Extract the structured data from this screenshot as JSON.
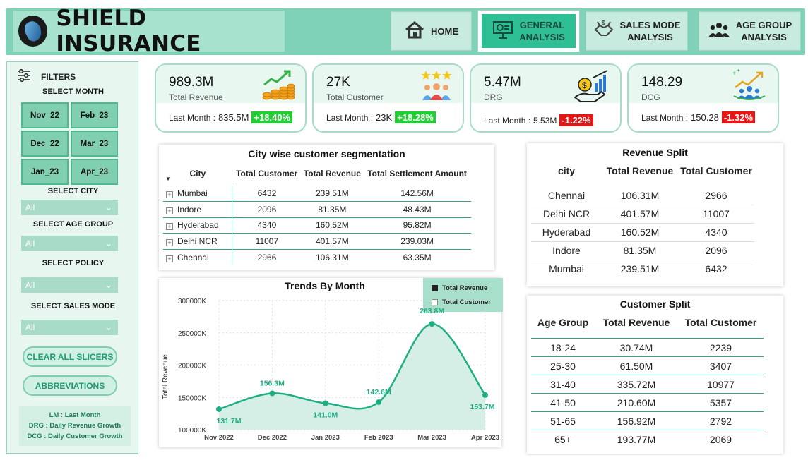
{
  "header": {
    "title": "SHIELD INSURANCE",
    "nav": [
      {
        "label_line1": "HOME",
        "label_line2": "",
        "icon": "home-icon"
      },
      {
        "label_line1": "GENERAL",
        "label_line2": "ANALYSIS",
        "icon": "presentation-chart-icon"
      },
      {
        "label_line1": "SALES MODE",
        "label_line2": "ANALYSIS",
        "icon": "handshake-icon"
      },
      {
        "label_line1": "AGE GROUP",
        "label_line2": "ANALYSIS",
        "icon": "people-group-icon"
      }
    ]
  },
  "sidebar": {
    "filters_title": "FILTERS",
    "select_month": "SELECT MONTH",
    "months": [
      "Nov_22",
      "Feb_23",
      "Dec_22",
      "Mar_23",
      "Jan_23",
      "Apr_23"
    ],
    "select_city": "SELECT CITY",
    "city_value": "All",
    "select_age_group": "SELECT  AGE GROUP",
    "age_value": "All",
    "select_policy": "SELECT POLICY",
    "policy_value": "All",
    "select_sales_mode": "SELECT SALES MODE",
    "sales_mode_value": "All",
    "clear_button": "CLEAR ALL SLICERS",
    "abbr_button": "ABBREVIATIONS",
    "abbreviations": [
      "LM : Last Month",
      "DRG : Daily Revenue Growth",
      "DCG : Daily Customer Growth"
    ]
  },
  "kpis": [
    {
      "value": "989.3M",
      "name": "Total Revenue",
      "lm_label": "Last Month : ",
      "lm_value": "835.5M",
      "change": "+18.40%",
      "trend": "up",
      "icon": "coins-growth-icon"
    },
    {
      "value": "27K",
      "name": "Total Customer",
      "lm_label": "Last Month : ",
      "lm_value": "23K",
      "change": "+18.28%",
      "trend": "up",
      "icon": "customers-rating-icon"
    },
    {
      "value": "5.47M",
      "name": "DRG",
      "lm_label": "Last Month : ",
      "lm_value": "5.53M",
      "change": "-1.22%",
      "trend": "down",
      "icon": "money-hand-chart-icon"
    },
    {
      "value": "148.29",
      "name": "DCG",
      "lm_label": "Last Month : ",
      "lm_value": "150.28",
      "change": "-1.32%",
      "trend": "down",
      "icon": "group-growth-icon"
    }
  ],
  "city_segmentation": {
    "title": "City wise customer segmentation",
    "columns": [
      "City",
      "Total Customer",
      "Total Revenue",
      "Total Settlement Amount"
    ],
    "rows": [
      [
        "Mumbai",
        "6432",
        "239.51M",
        "142.56M"
      ],
      [
        "Indore",
        "2096",
        "81.35M",
        "48.43M"
      ],
      [
        "Hyderabad",
        "4340",
        "160.52M",
        "95.82M"
      ],
      [
        "Delhi NCR",
        "11007",
        "401.57M",
        "239.03M"
      ],
      [
        "Chennai",
        "2966",
        "106.31M",
        "63.35M"
      ]
    ]
  },
  "revenue_split": {
    "title": "Revenue Split",
    "columns": [
      "city",
      "Total Revenue",
      "Total Customer"
    ],
    "rows": [
      [
        "Chennai",
        "106.31M",
        "2966"
      ],
      [
        "Delhi NCR",
        "401.57M",
        "11007"
      ],
      [
        "Hyderabad",
        "160.52M",
        "4340"
      ],
      [
        "Indore",
        "81.35M",
        "2096"
      ],
      [
        "Mumbai",
        "239.51M",
        "6432"
      ]
    ]
  },
  "customer_split": {
    "title": "Customer Split",
    "columns": [
      "Age Group",
      "Total Revenue",
      "Total Customer"
    ],
    "rows": [
      [
        "18-24",
        "30.74M",
        "2239"
      ],
      [
        "25-30",
        "61.50M",
        "3407"
      ],
      [
        "31-40",
        "335.72M",
        "10977"
      ],
      [
        "41-50",
        "210.60M",
        "5357"
      ],
      [
        "51-65",
        "156.92M",
        "2792"
      ],
      [
        "65+",
        "193.77M",
        "2069"
      ]
    ]
  },
  "chart_data": {
    "type": "area",
    "title": "Trends By Month",
    "ylabel": "Total Revenue",
    "xlabel": "",
    "categories": [
      "Nov 2022",
      "Dec 2022",
      "Jan 2023",
      "Feb 2023",
      "Mar 2023",
      "Apr 2023"
    ],
    "series": [
      {
        "name": "Total Revenue",
        "values": [
          131.7,
          156.3,
          141.0,
          142.6,
          263.8,
          153.7
        ],
        "labels": [
          "131.7M",
          "156.3M",
          "141.0M",
          "142.6M",
          "263.8M",
          "153.7M"
        ]
      }
    ],
    "legend": [
      "Total Revenue",
      "Total Customer"
    ],
    "yticks": [
      "100000K",
      "150000K",
      "200000K",
      "250000K",
      "300000K"
    ],
    "ylim": [
      100,
      300
    ],
    "grid": true,
    "colors": {
      "line": "#1fae84",
      "fill": "#d5efe6",
      "legend_revenue": "#222222",
      "legend_customer": "#ffffff"
    }
  }
}
